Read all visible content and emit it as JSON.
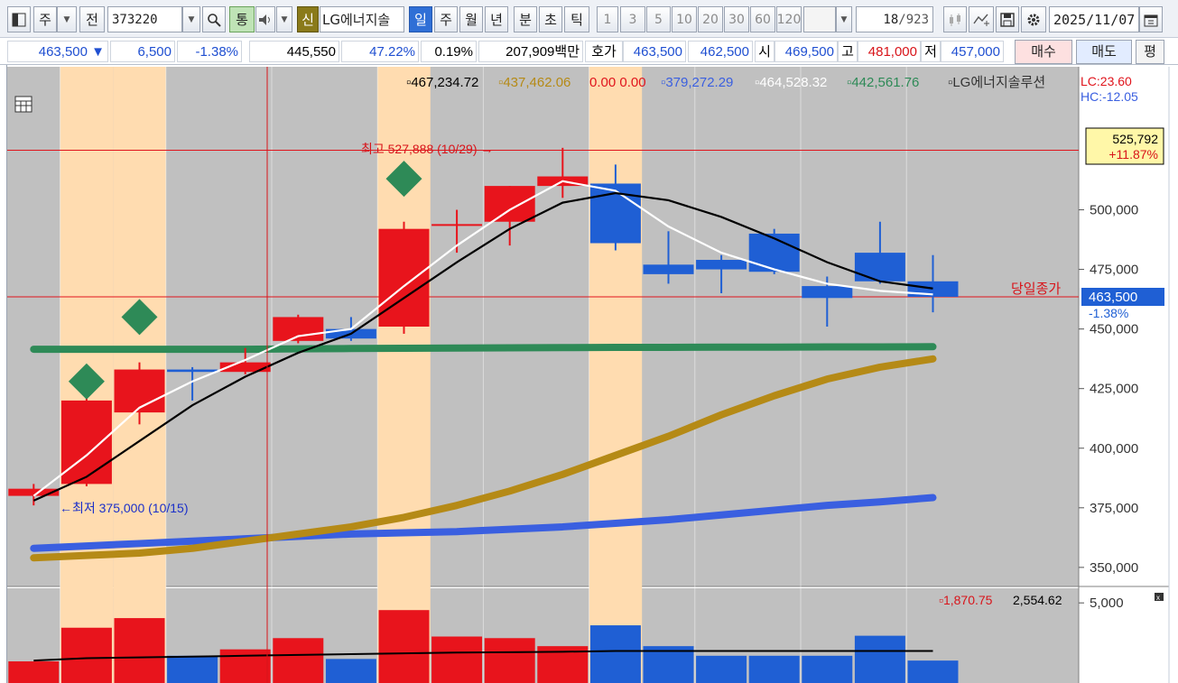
{
  "toolbar": {
    "market": "주",
    "prev_label": "전",
    "code": "373220",
    "tong": "통",
    "shin": "신",
    "stock_name": "LG에너지솔",
    "periods": [
      "일",
      "주",
      "월",
      "년",
      "분",
      "초",
      "틱"
    ],
    "active_period": "일",
    "intervals": [
      "1",
      "3",
      "5",
      "10",
      "20",
      "30",
      "60",
      "120"
    ],
    "page_count": "18",
    "page_total": "/923",
    "date": "2025/11/07"
  },
  "quote": {
    "price": "463,500 ▼",
    "change": "6,500",
    "change_pct": "-1.38%",
    "prev": "445,550",
    "rate": "47.22%",
    "turnover": "0.19%",
    "amount": "207,909백만",
    "hoga_label": "호가",
    "ask": "463,500",
    "bid": "462,500",
    "open_label": "시",
    "open": "469,500",
    "high_label": "고",
    "high": "481,000",
    "low_label": "저",
    "low": "457,000",
    "buy_btn": "매수",
    "sell_btn": "매도",
    "extra_btn": "평"
  },
  "legend": {
    "ma1": "467,234.72",
    "ma2": "437,462.06",
    "ma3": "0.00 0.00",
    "ma4": "379,272.29",
    "ma5": "464,528.32",
    "ma6": "442,561.76",
    "name": "LG에너지솔루션",
    "colors": {
      "ma1": "#000000",
      "ma2": "#b58a16",
      "ma3": "#e0141c",
      "ma4": "#3a5fe0",
      "ma5": "#ffffff",
      "ma6": "#2e8a57"
    },
    "lc": "LC:23.60",
    "hc": "HC:-12.05"
  },
  "annotations": {
    "high_note": "최고 527,888 (10/29) →",
    "low_note": "←최저 375,000 (10/15)",
    "close_label": "당일종가",
    "top_box_value": "525,792",
    "top_box_pct": "+11.87%",
    "current_price": "463,500",
    "current_pct": "-1.38%"
  },
  "volume_legend": {
    "a": "1,870.75",
    "b": "2,554.62"
  },
  "colors": {
    "up": "#e8141c",
    "down": "#1f5fd4",
    "bg": "#c0c0c0",
    "highlight": "#ffdcb0"
  },
  "chart_data": {
    "type": "candlestick",
    "y_ticks": [
      350000,
      375000,
      400000,
      425000,
      450000,
      475000,
      500000
    ],
    "y_tick_labels": [
      "350,000",
      "375,000",
      "400,000",
      "425,000",
      "450,000",
      "475,000",
      "500,000"
    ],
    "ylim": [
      342000,
      560000
    ],
    "candles": [
      {
        "o": 380000,
        "h": 385000,
        "l": 376000,
        "c": 383000
      },
      {
        "o": 385000,
        "h": 421000,
        "l": 384000,
        "c": 420000
      },
      {
        "o": 415000,
        "h": 436000,
        "l": 410000,
        "c": 433000
      },
      {
        "o": 433000,
        "h": 434000,
        "l": 420000,
        "c": 432000
      },
      {
        "o": 432000,
        "h": 442000,
        "l": 431000,
        "c": 436000
      },
      {
        "o": 445000,
        "h": 456000,
        "l": 444000,
        "c": 455000
      },
      {
        "o": 450000,
        "h": 455000,
        "l": 445000,
        "c": 446000
      },
      {
        "o": 451000,
        "h": 495000,
        "l": 448000,
        "c": 492000
      },
      {
        "o": 494000,
        "h": 500000,
        "l": 482000,
        "c": 494000
      },
      {
        "o": 495000,
        "h": 510000,
        "l": 485000,
        "c": 510000
      },
      {
        "o": 510000,
        "h": 526000,
        "l": 505000,
        "c": 514000
      },
      {
        "o": 511000,
        "h": 519000,
        "l": 483000,
        "c": 486000
      },
      {
        "o": 477000,
        "h": 491000,
        "l": 469000,
        "c": 473000
      },
      {
        "o": 479000,
        "h": 481000,
        "l": 465000,
        "c": 475000
      },
      {
        "o": 490000,
        "h": 492000,
        "l": 473000,
        "c": 474000
      },
      {
        "o": 468000,
        "h": 472000,
        "l": 451000,
        "c": 463000
      },
      {
        "o": 482000,
        "h": 495000,
        "l": 469000,
        "c": 470000
      },
      {
        "o": 470000,
        "h": 481000,
        "l": 457000,
        "c": 463500
      }
    ],
    "ma_black": [
      378000,
      388000,
      403000,
      418000,
      430000,
      440000,
      448000,
      463000,
      478000,
      492000,
      503000,
      507000,
      504000,
      497000,
      488000,
      478000,
      470000,
      467000
    ],
    "ma_white": [
      380000,
      397000,
      417000,
      428000,
      437000,
      447000,
      450000,
      468000,
      485000,
      500000,
      512000,
      508000,
      493000,
      482000,
      475000,
      469000,
      466000,
      464500
    ],
    "ma_green": [
      441500,
      441500,
      441500,
      441500,
      441500,
      441700,
      441800,
      441900,
      442000,
      442100,
      442200,
      442300,
      442300,
      442400,
      442400,
      442500,
      442500,
      442561
    ],
    "ma_gold": [
      354000,
      355000,
      356000,
      358000,
      361000,
      364000,
      367000,
      371000,
      376000,
      382000,
      389000,
      397000,
      405000,
      414000,
      422000,
      429000,
      434000,
      437462
    ],
    "ma_blue": [
      358000,
      359000,
      360000,
      361000,
      362000,
      363000,
      364000,
      364500,
      365000,
      366000,
      367000,
      368500,
      370000,
      372000,
      374000,
      376000,
      377500,
      379272
    ],
    "high_line": 525000,
    "close_line": 463500,
    "highlight_columns": [
      1,
      2,
      7,
      11
    ],
    "diamonds": [
      {
        "index": 1,
        "value": 428000
      },
      {
        "index": 2,
        "value": 455000
      },
      {
        "index": 7,
        "value": 513000
      }
    ],
    "volume": {
      "ylim": [
        0,
        5800
      ],
      "tick": 5000,
      "tick_label": "5,000",
      "bars": [
        1350,
        3450,
        4050,
        1700,
        2100,
        2800,
        1500,
        4550,
        2900,
        2800,
        2300,
        3600,
        2300,
        1700,
        1700,
        1700,
        2950,
        1400
      ],
      "avg": [
        1400,
        1550,
        1600,
        1650,
        1700,
        1750,
        1800,
        1850,
        1900,
        1920,
        1950,
        2000,
        2000,
        2000,
        2000,
        2000,
        2000,
        2000
      ]
    }
  }
}
